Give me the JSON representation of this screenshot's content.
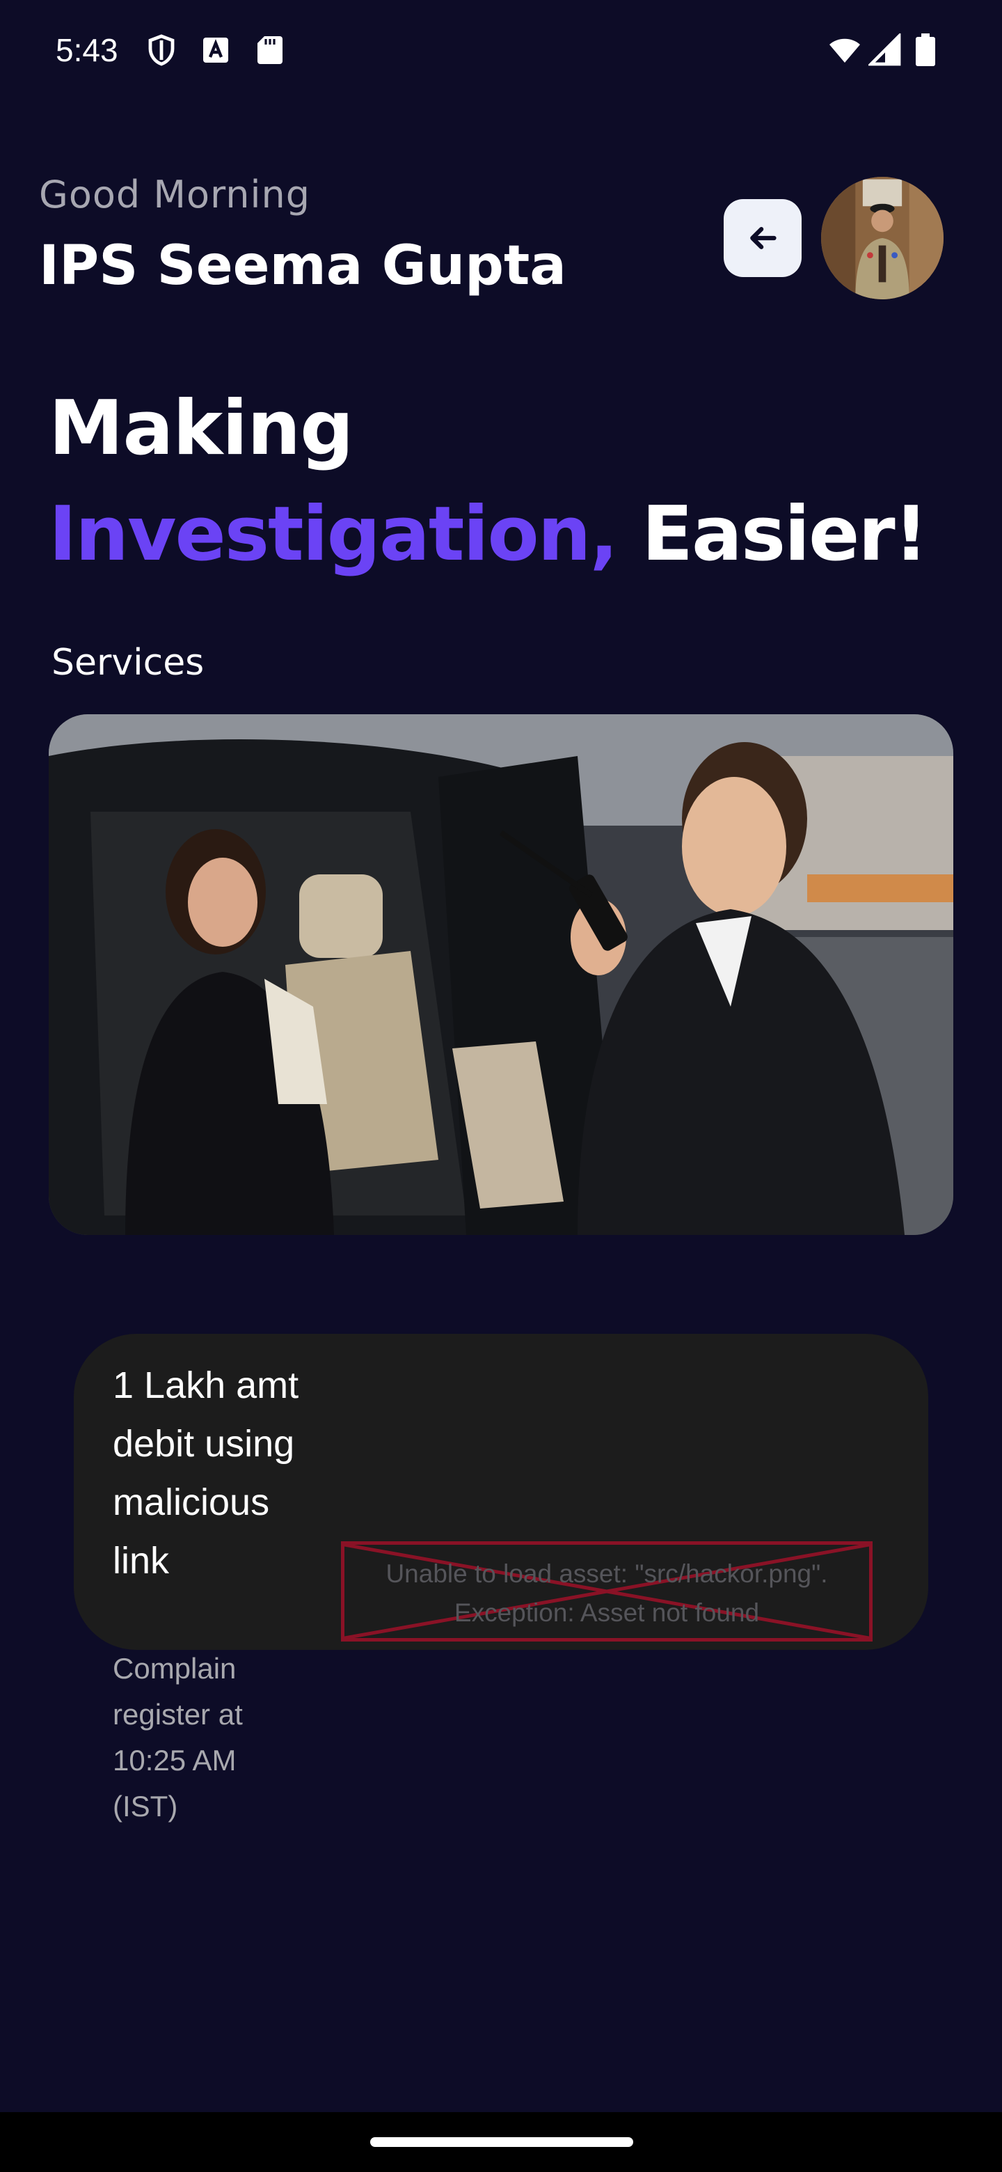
{
  "status_bar": {
    "time": "5:43",
    "icons": [
      "shield-icon",
      "font-icon",
      "sd-card-icon",
      "wifi-icon",
      "cellular-signal-icon",
      "battery-icon"
    ]
  },
  "header": {
    "greeting": "Good Morning",
    "user_name": "IPS Seema Gupta",
    "back_icon": "arrow-left-icon"
  },
  "hero": {
    "line1": "Making",
    "accent_word": "Investigation,",
    "plain_word": "Easier!"
  },
  "services": {
    "label": "Services"
  },
  "complaint": {
    "title": "1 Lakh amt debit using malicious link",
    "time": "Complain register at 10:25 AM (IST)",
    "asset_error_line1": "Unable to load asset: \"src/hackor.png\".",
    "asset_error_line2": "Exception: Asset not found"
  },
  "colors": {
    "background": "#0d0c27",
    "accent": "#6b43f5",
    "card": "#1c1c1c",
    "error": "#8a1226"
  }
}
